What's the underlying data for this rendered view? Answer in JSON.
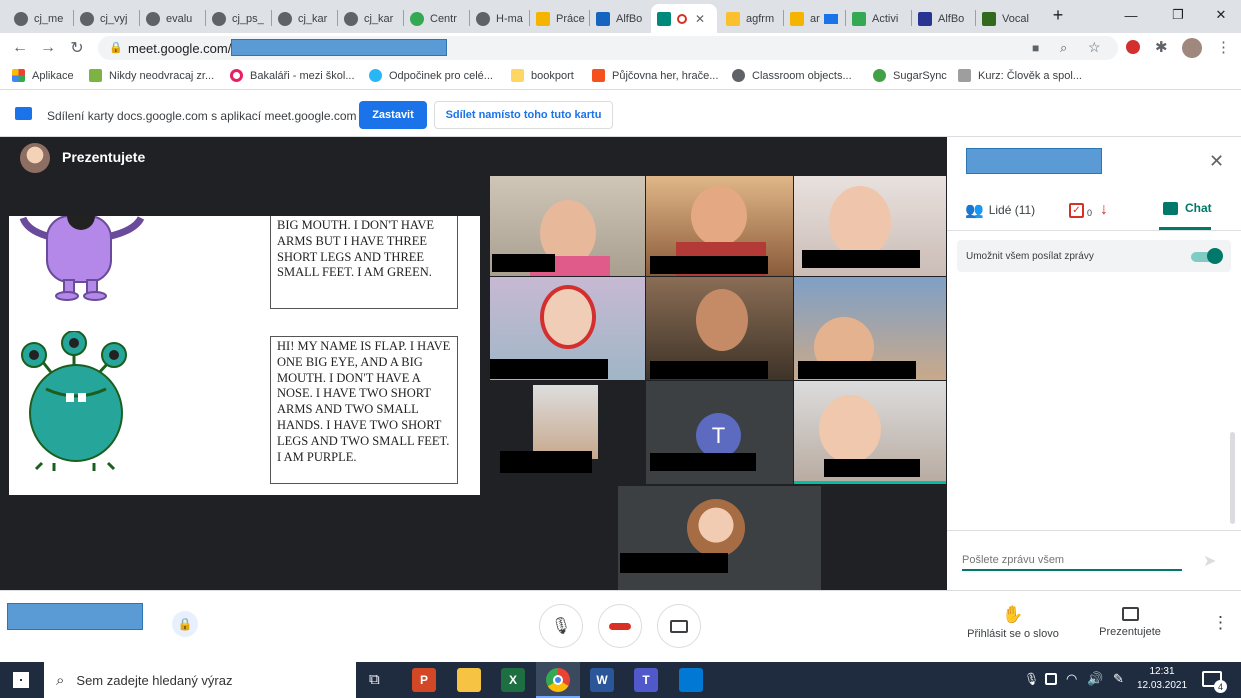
{
  "tabs": [
    "cj_me",
    "cj_vyj",
    "evalu",
    "cj_ps_",
    "cj_kar",
    "cj_kar",
    "Centr",
    "H-ma",
    "Práce",
    "AlfBo",
    "",
    "agfrm",
    "ar",
    "Activi",
    "AlfBo",
    "Vocal"
  ],
  "browser": {
    "url_prefix": "meet.google.com/",
    "new_tab": "+"
  },
  "bookmarks": [
    "Aplikace",
    "Nikdy neodvracaj zr...",
    "Bakaláři - mezi škol...",
    "Odpočinek pro celé...",
    "bookport",
    "Půjčovna her, hrače...",
    "Classroom objects...",
    "SugarSync",
    "Kurz: Člověk a spol..."
  ],
  "sharebar": {
    "message": "Sdílení karty docs.google.com s aplikací meet.google.com",
    "stop_label": "Zastavit",
    "share_instead_label": "Sdílet namísto toho tuto kartu"
  },
  "meet": {
    "presenting_label": "Prezentujete",
    "slide": {
      "text1": "BIG MOUTH. I DON'T HAVE ARMS BUT I HAVE THREE SHORT LEGS AND THREE SMALL FEET. I AM GREEN.",
      "text2": "HI! MY NAME IS FLAP. I HAVE ONE BIG EYE, AND A BIG MOUTH. I DON'T HAVE A NOSE. I HAVE TWO SHORT ARMS AND TWO SMALL HANDS. I HAVE TWO SHORT LEGS AND TWO SMALL FEET. I AM PURPLE."
    },
    "participant_initial": "T"
  },
  "panel": {
    "people_label": "Lidé (11)",
    "tasks_count": "0",
    "chat_label": "Chat",
    "allow_messages_label": "Umožnit všem posílat zprávy",
    "message_placeholder": "Pošlete zprávu všem"
  },
  "bottombar": {
    "raise_hand_label": "Přihlásit se o slovo",
    "present_label": "Prezentujete"
  },
  "taskbar": {
    "search_placeholder": "Sem zadejte hledaný výraz",
    "time": "12:31",
    "date": "12.03.2021",
    "notification_count": "4"
  },
  "colors": {
    "accent": "#1a73e8",
    "meet_teal": "#00796b",
    "end_call": "#d93025"
  }
}
